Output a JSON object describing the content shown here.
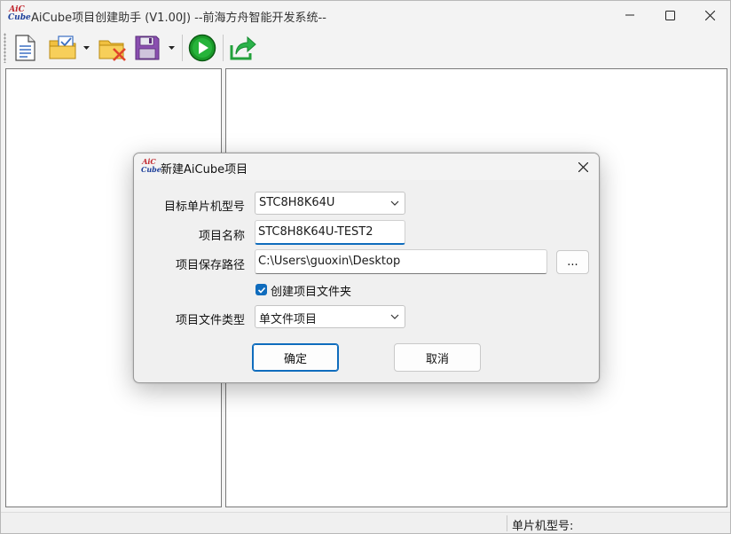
{
  "app": {
    "logo_text_top": "AiC",
    "logo_text_bottom": "Cube",
    "title": "AiCube项目创建助手 (V1.00J) --前海方舟智能开发系统--",
    "caption_buttons": {
      "minimize": "—",
      "maximize": "☐",
      "close": "✕"
    }
  },
  "toolbar": {
    "items": [
      {
        "name": "new-document-icon"
      },
      {
        "name": "open-project-icon",
        "has_dropdown": true
      },
      {
        "name": "close-project-icon"
      },
      {
        "name": "save-icon",
        "has_dropdown": true
      },
      {
        "name": "run-icon"
      },
      {
        "name": "export-icon"
      }
    ]
  },
  "status_bar": {
    "mcu_label": "单片机型号:"
  },
  "dialog": {
    "title": "新建AiCube项目",
    "close_glyph": "✕",
    "fields": {
      "mcu_model": {
        "label": "目标单片机型号",
        "value": "STC8H8K64U"
      },
      "project_name": {
        "label": "项目名称",
        "value": "STC8H8K64U-TEST2"
      },
      "save_path": {
        "label": "项目保存路径",
        "value": "C:\\Users\\guoxin\\Desktop",
        "browse_label": "..."
      },
      "create_folder": {
        "label": "创建项目文件夹",
        "checked": true
      },
      "file_type": {
        "label": "项目文件类型",
        "value": "单文件项目"
      }
    },
    "ok_label": "确定",
    "cancel_label": "取消"
  },
  "colors": {
    "accent": "#0f6cbd",
    "logo_red": "#c0262d",
    "logo_blue": "#1d3f9a"
  }
}
